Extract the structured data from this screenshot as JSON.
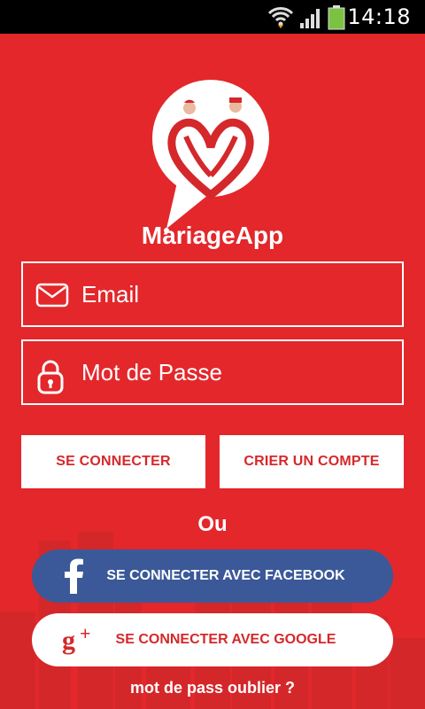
{
  "status_bar": {
    "time": "14:18",
    "icons": [
      "wifi-icon",
      "signal-icon",
      "battery-icon"
    ],
    "battery_color": "#7cc242"
  },
  "app": {
    "name": "MariageApp",
    "logo": "heart-couple-logo",
    "background_color": "#e3272b",
    "accent_color": "#d5282b"
  },
  "form": {
    "email": {
      "placeholder": "Email",
      "icon": "envelope-icon"
    },
    "password": {
      "placeholder": "Mot de Passe",
      "icon": "lock-icon"
    }
  },
  "buttons": {
    "login": "SE CONNECTER",
    "signup": "CRIER UN COMPTE"
  },
  "separator": "Ou",
  "social": {
    "facebook": {
      "label": "SE CONNECTER AVEC FACEBOOK",
      "icon": "facebook-icon",
      "color": "#3b5998"
    },
    "google": {
      "label": "SE CONNECTER AVEC GOOGLE",
      "icon": "google-plus-icon",
      "color": "#ffffff"
    }
  },
  "forgot_password": "mot de pass oublier ?"
}
